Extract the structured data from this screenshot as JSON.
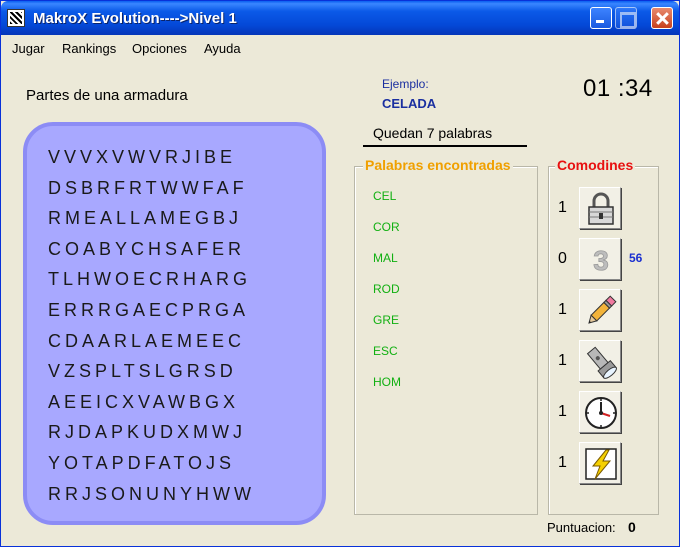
{
  "window": {
    "title": "MakroX Evolution---->Nivel 1"
  },
  "menu": [
    "Jugar",
    "Rankings",
    "Opciones",
    "Ayuda"
  ],
  "topic": "Partes de una armadura",
  "example": {
    "label": "Ejemplo:",
    "value": "CELADA"
  },
  "timer": "01 :34",
  "remaining": "Quedan 7  palabras",
  "grid": [
    "VVVXVWVRJIBE",
    "DSBRFRTWWFAF",
    "RMEALLAMEGBJ",
    "COABYCHSAFER",
    "TLHWOECRHARG",
    "ERRRGAECPRGA",
    "CDAARLAEMEEC",
    "VZSPLTSLGRSD",
    "AEEICXVAWBGX",
    "RJDAPKUDXMWJ",
    "YOTAPDFATOJS",
    "RRJSONUNYHWW"
  ],
  "found_panel": {
    "title": "Palabras encontradas",
    "words": [
      "CEL",
      "COR",
      "MAL",
      "ROD",
      "GRE",
      "ESC",
      "HOM"
    ]
  },
  "comodines": {
    "title": "Comodines",
    "items": [
      {
        "count": "1",
        "icon": "padlock-icon"
      },
      {
        "count": "0",
        "icon": "number-three-icon",
        "extra": "56"
      },
      {
        "count": "1",
        "icon": "pencil-eraser-icon"
      },
      {
        "count": "1",
        "icon": "flashlight-icon"
      },
      {
        "count": "1",
        "icon": "clock-icon"
      },
      {
        "count": "1",
        "icon": "lightning-icon"
      }
    ]
  },
  "score": {
    "label": "Puntuacion:",
    "value": "0"
  },
  "colors": {
    "title_bar": "#0449d8",
    "board": "#a8a8ff",
    "found_title": "#f0a000",
    "found_words": "#12b012",
    "comodines_title": "#e81010",
    "example": "#1a2fa0"
  }
}
